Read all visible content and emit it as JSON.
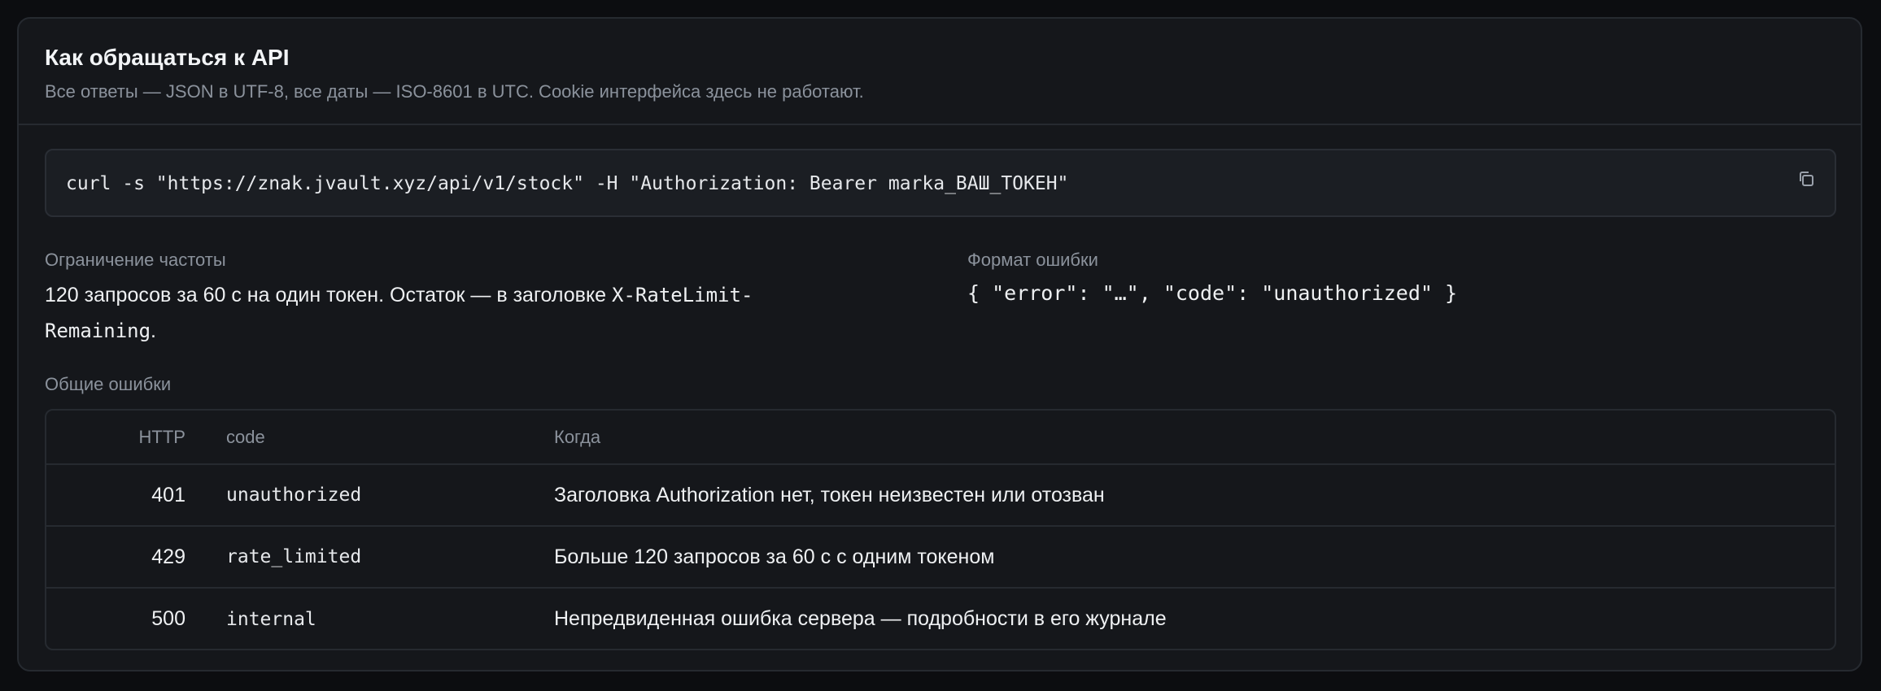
{
  "header": {
    "title": "Как обращаться к API",
    "subtitle": "Все ответы — JSON в UTF-8, все даты — ISO-8601 в UTC. Cookie интерфейса здесь не работают."
  },
  "example": {
    "command": "curl -s \"https://znak.jvault.xyz/api/v1/stock\" -H \"Authorization: Bearer marka_ВАШ_ТОКЕН\"",
    "copy_icon": "copy-icon"
  },
  "rate_limit": {
    "label": "Ограничение частоты",
    "text_before": "120 запросов за 60 с на один токен. Остаток — в заголовке ",
    "header_name": "X-RateLimit-",
    "header_name_cont": "Remaining",
    "text_after": "."
  },
  "error_format": {
    "label": "Формат ошибки",
    "example": "{ \"error\": \"…\", \"code\": \"unauthorized\" }"
  },
  "common_errors": {
    "label": "Общие ошибки",
    "columns": [
      "HTTP",
      "code",
      "Когда"
    ],
    "rows": [
      {
        "http": "401",
        "code": "unauthorized",
        "when": "Заголовка Authorization нет, токен неизвестен или отозван"
      },
      {
        "http": "429",
        "code": "rate_limited",
        "when": "Больше 120 запросов за 60 с с одним токеном"
      },
      {
        "http": "500",
        "code": "internal",
        "when": "Непредвиденная ошибка сервера — подробности в его журнале"
      }
    ]
  },
  "colors": {
    "background": "#0c0d10",
    "card": "#15171b",
    "border": "#262a30",
    "muted_text": "#8b929c"
  }
}
